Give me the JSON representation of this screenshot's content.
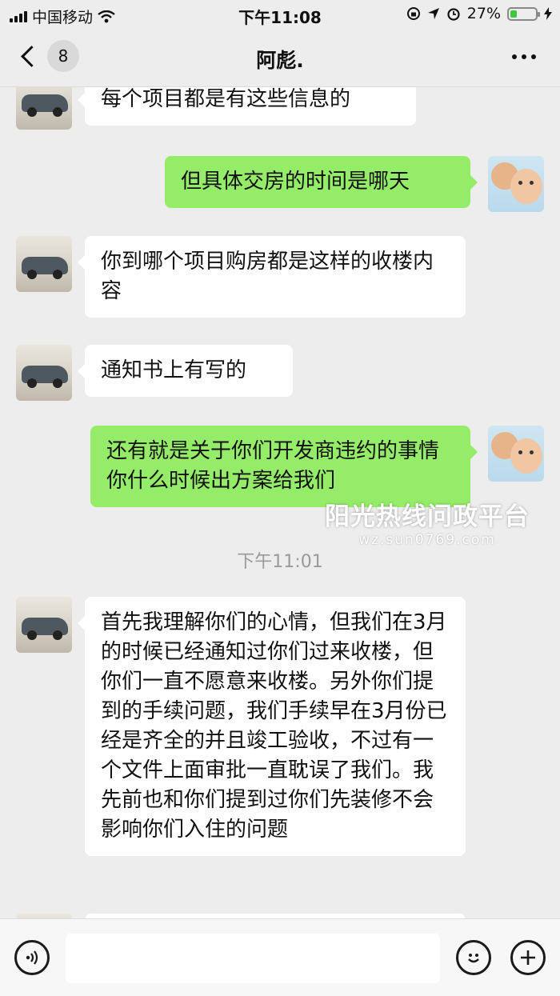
{
  "status_bar": {
    "carrier": "中国移动",
    "time": "下午11:08",
    "battery_percent": "27%",
    "battery_level": 0.27
  },
  "nav": {
    "unread_count": "8",
    "title": "阿彪."
  },
  "messages": [
    {
      "side": "left",
      "text": "每个项目都是有这些信息的"
    },
    {
      "side": "right",
      "text": "但具体交房的时间是哪天"
    },
    {
      "side": "left",
      "text": "你到哪个项目购房都是这样的收楼内容"
    },
    {
      "side": "left",
      "text": "通知书上有写的"
    },
    {
      "side": "right",
      "text": "还有就是关于你们开发商违约的事情你什么时候出方案给我们"
    },
    {
      "side": "left",
      "text": "首先我理解你们的心情，但我们在3月的时候已经通知过你们过来收楼，但你们一直不愿意来收楼。另外你们提到的手续问题，我们手续早在3月份已经是齐全的并且竣工验收，不过有一个文件上面审批一直耽误了我们。我先前也和你们提到过你们先装修不会影响你们入住的问题"
    }
  ],
  "timestamp": "下午11:01",
  "watermark": {
    "main": "阳光热线问政平台",
    "sub": "wz.sun0769.com"
  },
  "colors": {
    "background": "#ededed",
    "self_bubble": "#95ec69",
    "other_bubble": "#ffffff"
  }
}
